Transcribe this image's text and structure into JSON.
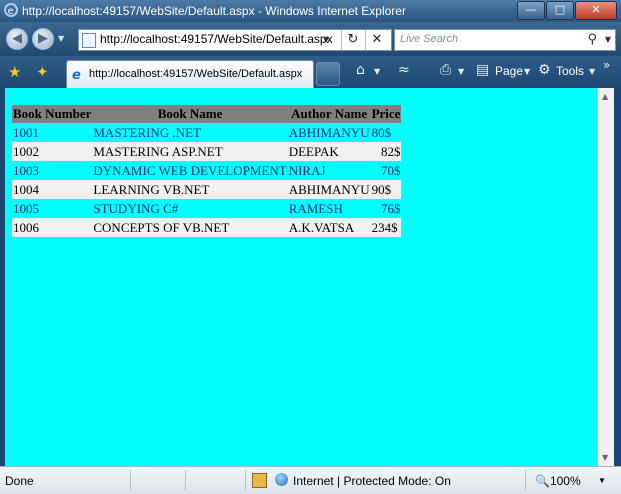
{
  "window": {
    "title": "http://localhost:49157/WebSite/Default.aspx - Windows Internet Explorer"
  },
  "toolbar": {
    "address": "http://localhost:49157/WebSite/Default.aspx",
    "search_placeholder": "Live Search",
    "tab_label": "http://localhost:49157/WebSite/Default.aspx",
    "page_label": "Page",
    "tools_label": "Tools"
  },
  "grid": {
    "headers": [
      "Book Number",
      "Book Name",
      "Author Name",
      "Price"
    ],
    "rows": [
      [
        "1001",
        "MASTERING .NET",
        "ABHIMANYU",
        "80$"
      ],
      [
        "1002",
        "MASTERING ASP.NET",
        "DEEPAK",
        "82$"
      ],
      [
        "1003",
        "DYNAMIC WEB DEVELOPMENT",
        "NIRAJ",
        "70$"
      ],
      [
        "1004",
        "LEARNING VB.NET",
        "ABHIMANYU",
        "90$"
      ],
      [
        "1005",
        "STUDYING C#",
        "RAMESH",
        "76$"
      ],
      [
        "1006",
        "CONCEPTS OF VB.NET",
        "A.K.VATSA",
        "234$"
      ]
    ]
  },
  "status": {
    "text": "Done",
    "zone": "Internet | Protected Mode: On",
    "zoom": "100%"
  },
  "colors": {
    "page_background": "#00ffff",
    "header_background": "#808080",
    "alt_row": "#f0f0f0"
  }
}
